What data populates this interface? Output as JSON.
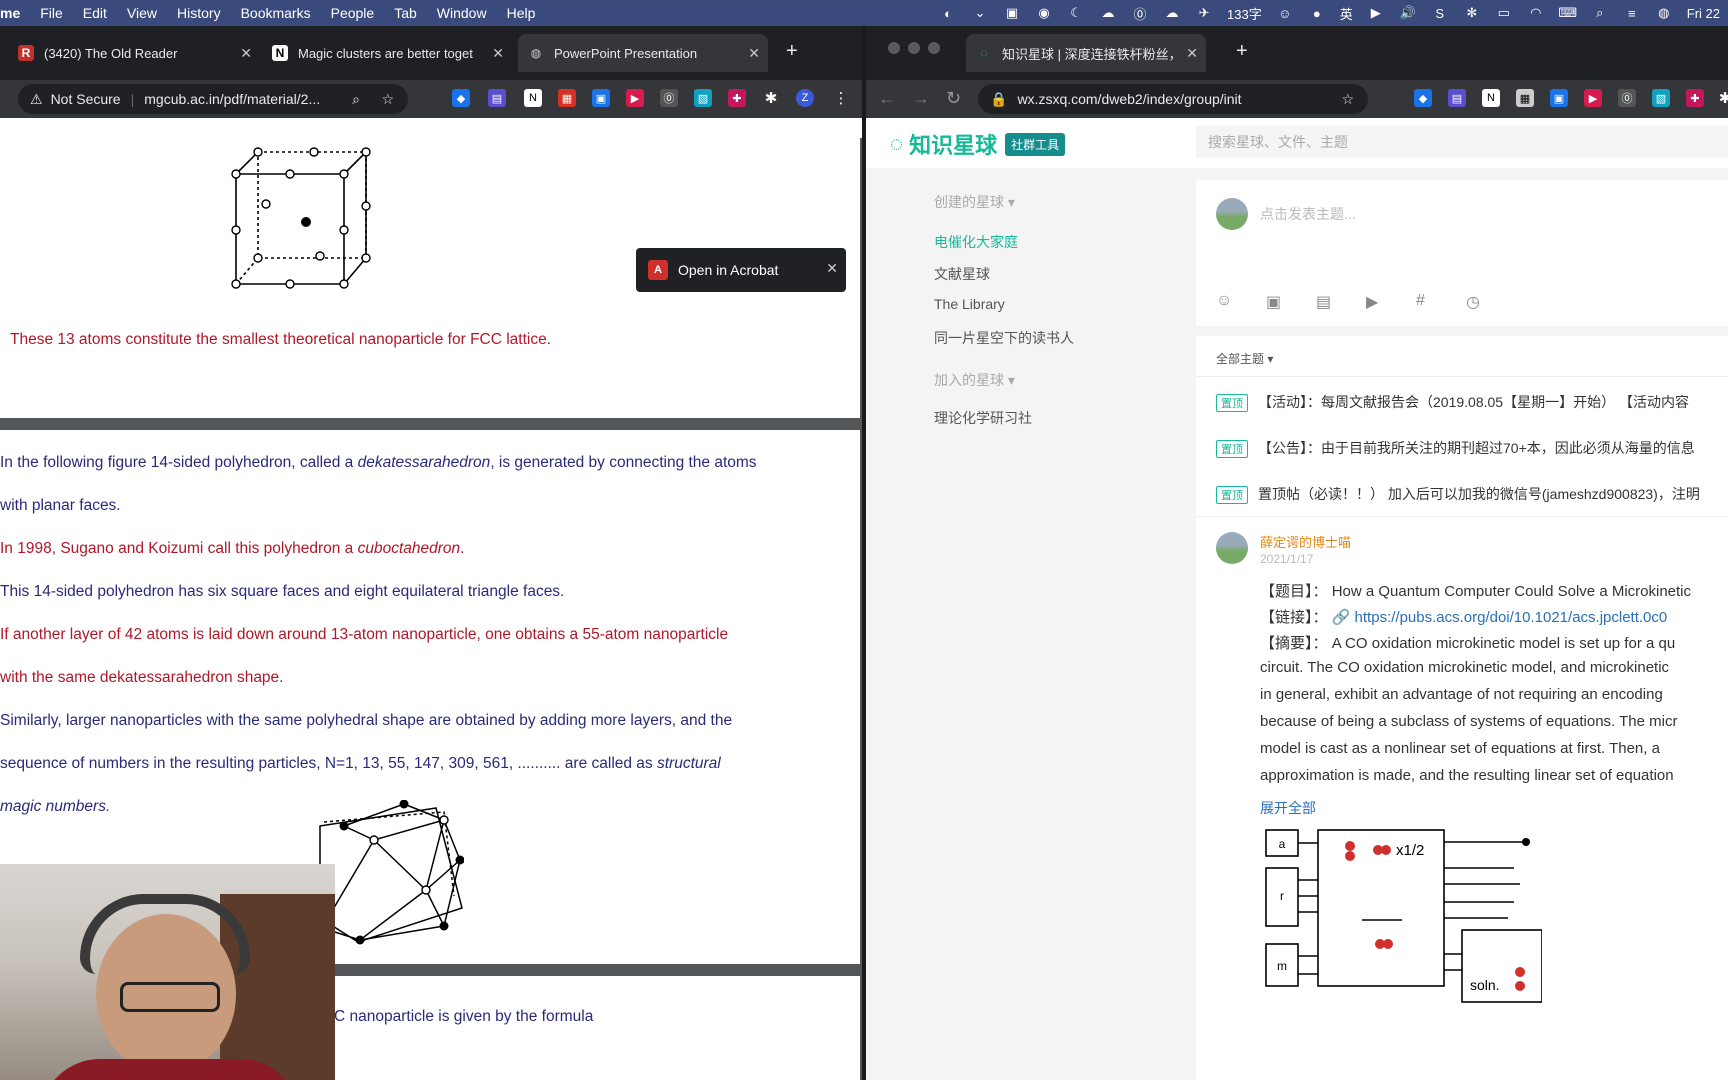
{
  "menubar": {
    "app": "me",
    "items": [
      "File",
      "Edit",
      "View",
      "History",
      "Bookmarks",
      "People",
      "Tab",
      "Window",
      "Help"
    ],
    "word_count": "133字",
    "ime": "英",
    "clock": "Fri 22"
  },
  "left_window": {
    "tabs": [
      {
        "title": "(3420) The Old Reader",
        "icon": "reader-icon"
      },
      {
        "title": "Magic clusters are better toget",
        "icon": "notion-icon"
      },
      {
        "title": "PowerPoint Presentation",
        "icon": "globe-icon"
      }
    ],
    "security": "Not Secure",
    "url": "mgcub.ac.in/pdf/material/2...",
    "profile": "Z",
    "acrobat_label": "Open in Acrobat",
    "page1": {
      "caption": "These 13 atoms constitute the smallest theoretical nanoparticle for FCC lattice."
    },
    "page2": {
      "l1a": "In the following figure 14-sided polyhedron, called a ",
      "l1b": "dekatessarahedron",
      "l1c": ", is generated by connecting the atoms",
      "l2": "with planar faces.",
      "l3a": "In 1998, Sugano and Koizumi call this polyhedron a ",
      "l3b": "cuboctahedron",
      "l3c": ".",
      "l4": "This 14-sided polyhedron has six square faces and eight equilateral triangle faces.",
      "l5": "If another layer of 42 atoms is laid down around 13-atom nanoparticle, one obtains a 55-atom nanoparticle",
      "l6": "with the same dekatessarahedron shape.",
      "l7": "Similarly, larger nanoparticles with the same polyhedral shape are obtained by adding more layers, and the",
      "l8a": "sequence of numbers in the resulting particles, N=1, 13, 55, 147, 309, 561, ..........  are called as ",
      "l8b": "structural",
      "l9": "magic numbers."
    },
    "page3": {
      "partial": "C nanoparticle is given by the formula"
    }
  },
  "right_window": {
    "tab": "知识星球 | 深度连接铁杆粉丝，",
    "url": "wx.zsxq.com/dweb2/index/group/init",
    "logo": "知识星球",
    "logo_tag": "社群工具",
    "search_placeholder": "搜索星球、文件、主题",
    "sidebar": {
      "created_header": "创建的星球",
      "items": [
        "电催化大家庭",
        "文献星球",
        "The Library",
        "同一片星空下的读书人"
      ],
      "joined_header": "加入的星球",
      "joined_items": [
        "理论化学研习社"
      ]
    },
    "compose_placeholder": "点击发表主题...",
    "filter": "全部主题",
    "pin_label": "置顶",
    "pinned": [
      "【活动】：每周文献报告会（2019.08.05【星期一】开始）  【活动内容",
      "【公告】：由于目前我所关注的期刊超过70+本，因此必须从海量的信息",
      "置顶帖（必读！！） 加入后可以加我的微信号(jameshzd900823)，注明"
    ],
    "post": {
      "author": "薛定谔的博士喵",
      "date": "2021/1/17",
      "title_label": "【题目】：",
      "title": "How a Quantum Computer Could Solve a Microkinetic",
      "link_label": "【链接】：",
      "link": "https://pubs.acs.org/doi/10.1021/acs.jpclett.0c0",
      "abstract_label": "【摘要】：",
      "abstract": [
        "A CO oxidation microkinetic model is set up for a qu",
        "circuit. The CO oxidation microkinetic model, and microkinetic",
        "in general, exhibit an advantage of not requiring an encoding",
        "because of being a subclass of systems of equations. The micr",
        "model is cast as a nonlinear set of equations at first. Then, a",
        "approximation is made, and the resulting linear set of equation"
      ],
      "expand": "展开全部",
      "fig_a": "a",
      "fig_r": "r",
      "fig_m": "m",
      "fig_x": "x1/2",
      "fig_soln": "soln."
    }
  }
}
